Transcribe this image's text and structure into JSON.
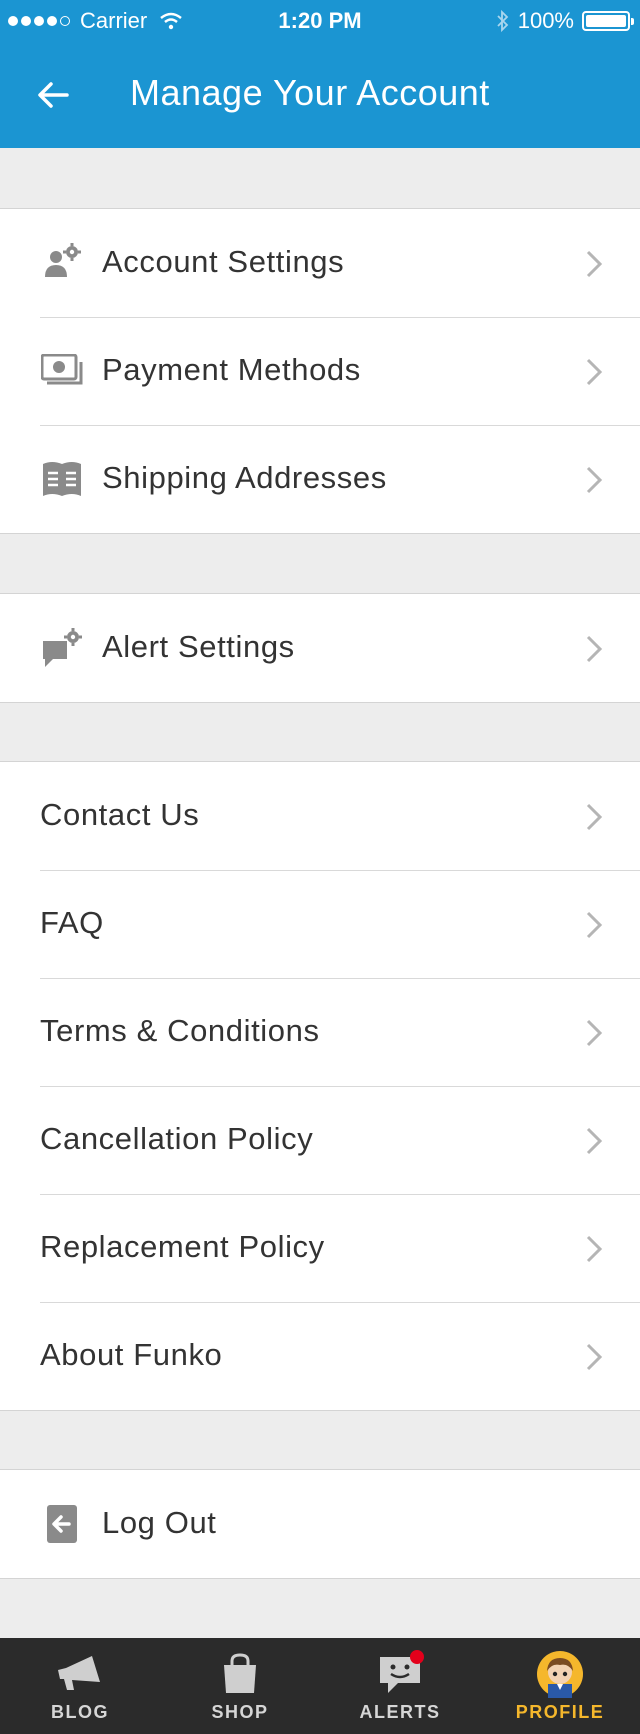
{
  "status_bar": {
    "carrier": "Carrier",
    "time": "1:20 PM",
    "battery": "100%"
  },
  "header": {
    "title": "Manage Your Account"
  },
  "account_group": {
    "items": [
      {
        "label": "Account Settings",
        "icon": "user-gear-icon"
      },
      {
        "label": "Payment Methods",
        "icon": "money-icon"
      },
      {
        "label": "Shipping Addresses",
        "icon": "address-book-icon"
      }
    ]
  },
  "alert_group": {
    "items": [
      {
        "label": "Alert Settings",
        "icon": "chat-gear-icon"
      }
    ]
  },
  "info_group": {
    "items": [
      {
        "label": "Contact Us"
      },
      {
        "label": "FAQ"
      },
      {
        "label": "Terms & Conditions"
      },
      {
        "label": "Cancellation Policy"
      },
      {
        "label": "Replacement Policy"
      },
      {
        "label": "About Funko"
      }
    ]
  },
  "logout_group": {
    "items": [
      {
        "label": "Log Out",
        "icon": "logout-icon"
      }
    ]
  },
  "tab_bar": {
    "tabs": [
      {
        "label": "BLOG",
        "icon": "megaphone-icon"
      },
      {
        "label": "SHOP",
        "icon": "shopping-bag-icon"
      },
      {
        "label": "ALERTS",
        "icon": "chat-bubble-icon"
      },
      {
        "label": "PROFILE",
        "icon": "avatar-icon"
      }
    ],
    "active_color": "#f5b72c",
    "inactive_color": "#d6d6d6"
  },
  "colors": {
    "brand": "#1b95d2",
    "background": "#ededed",
    "tab_bar": "#2b2b2b",
    "alert_badge": "#e3001b"
  }
}
